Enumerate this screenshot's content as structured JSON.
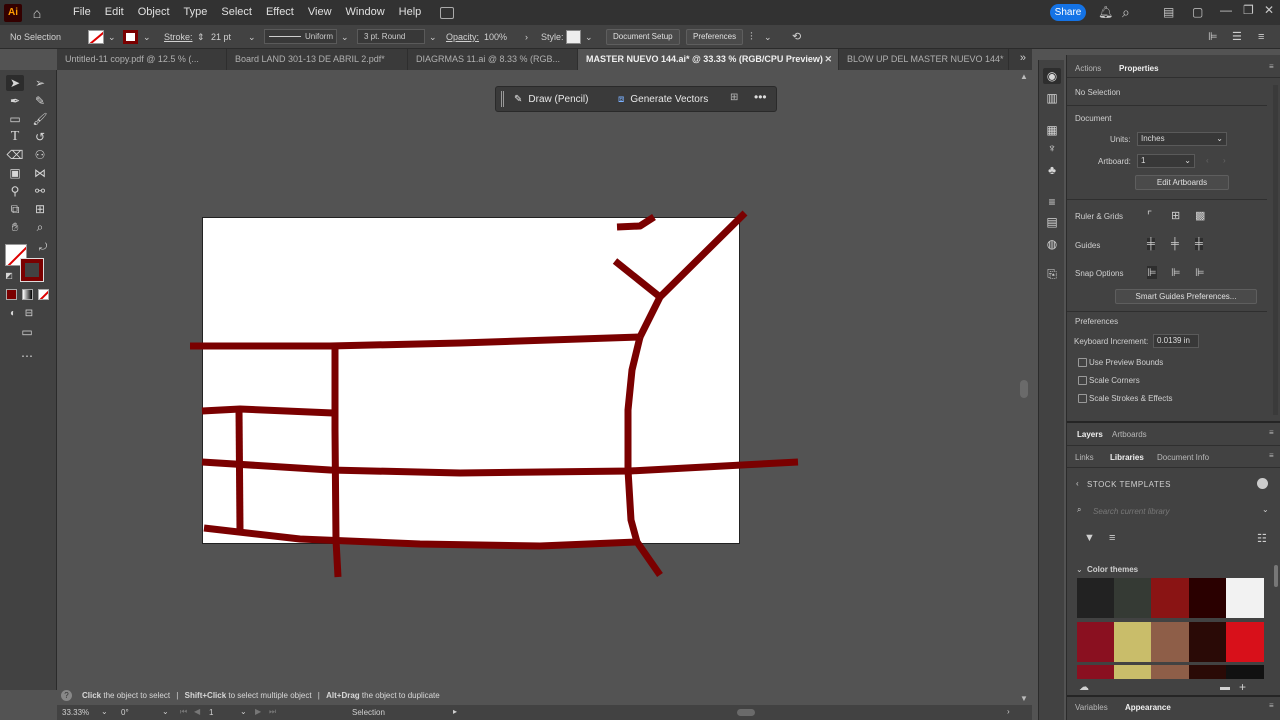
{
  "app": {
    "logo": "Ai"
  },
  "menu": [
    "File",
    "Edit",
    "Object",
    "Type",
    "Select",
    "Effect",
    "View",
    "Window",
    "Help"
  ],
  "share_label": "Share",
  "control": {
    "selection": "No Selection",
    "stroke_label": "Stroke:",
    "stroke_value": "21 pt",
    "profile": "Uniform",
    "brush": "3 pt. Round",
    "opacity_label": "Opacity:",
    "opacity_value": "100%",
    "style_label": "Style:",
    "document_setup": "Document Setup",
    "preferences": "Preferences"
  },
  "tabs": [
    "Untitled-11 copy.pdf @ 12.5 % (...",
    "Board LAND 301-13 DE ABRIL 2.pdf*",
    "DIAGRMAS 11.ai @ 8.33 % (RGB...",
    "MASTER NUEVO 144.ai* @ 33.33 % (RGB/CPU Preview)",
    "BLOW UP DEL MASTER NUEVO 144*"
  ],
  "context_bar": {
    "draw": "Draw (Pencil)",
    "generate": "Generate Vectors"
  },
  "status": {
    "hint1_bold": "Click",
    "hint1": " the object to select",
    "hint2_bold": "Shift+Click",
    "hint2": " to select multiple object",
    "hint3_bold": "Alt+Drag",
    "hint3": " the object to duplicate"
  },
  "bottom": {
    "zoom": "33.33%",
    "rotation": "0°",
    "artboard": "1",
    "tool": "Selection"
  },
  "panel": {
    "tab_actions": "Actions",
    "tab_properties": "Properties",
    "no_selection": "No Selection",
    "document": "Document",
    "units_label": "Units:",
    "units_value": "Inches",
    "artboard_label": "Artboard:",
    "artboard_value": "1",
    "edit_artboards": "Edit Artboards",
    "ruler_grids": "Ruler & Grids",
    "guides": "Guides",
    "snap_options": "Snap Options",
    "smart_guides": "Smart Guides Preferences...",
    "preferences": "Preferences",
    "keyboard_label": "Keyboard Increment:",
    "keyboard_value": "0.0139 in",
    "chk_preview": "Use Preview Bounds",
    "chk_corners": "Scale Corners",
    "chk_strokes": "Scale Strokes & Effects",
    "tab_layers": "Layers",
    "tab_artboards": "Artboards",
    "tab_links": "Links",
    "tab_libraries": "Libraries",
    "tab_docinfo": "Document Info",
    "stock_templates": "STOCK TEMPLATES",
    "search_placeholder": "Search current library",
    "color_themes": "Color themes",
    "tab_variables": "Variables",
    "tab_appearance": "Appearance"
  },
  "colors": {
    "stroke": "#7a0000",
    "theme_row1": [
      "#222222",
      "#353a34",
      "#8a1414",
      "#2a0000",
      "#f2f2f2"
    ],
    "theme_row2": [
      "#8a1020",
      "#c9bd6a",
      "#8e5e48",
      "#2a0a06",
      "#d8101a"
    ]
  }
}
